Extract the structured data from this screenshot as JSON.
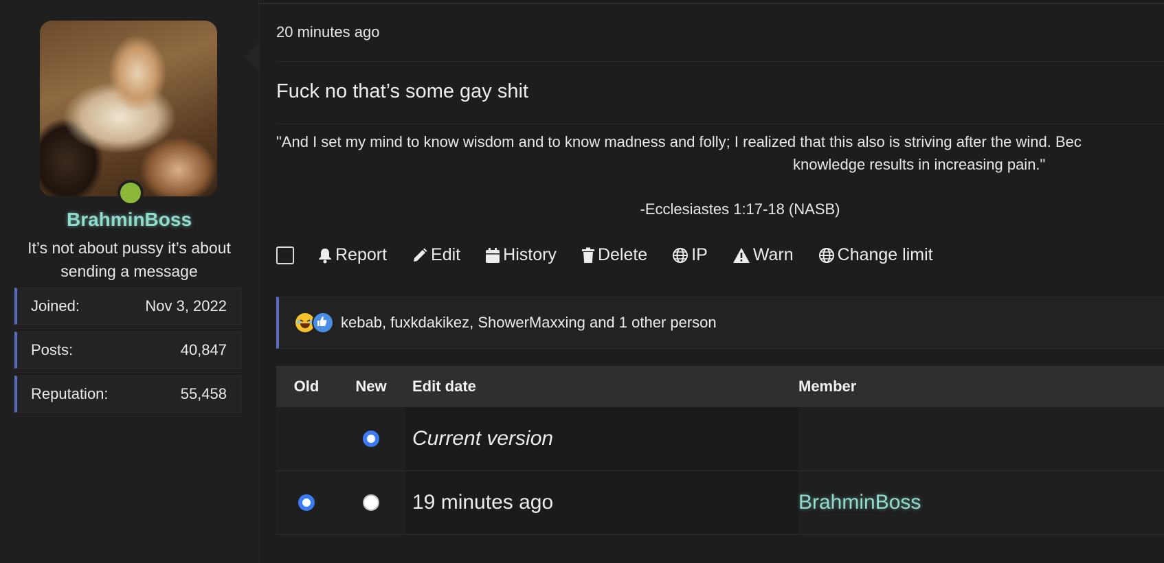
{
  "sidebar": {
    "username": "BrahminBoss",
    "user_title": "It’s not about pussy it’s about sending a message",
    "stats": [
      {
        "label": "Joined:",
        "value": "Nov 3, 2022"
      },
      {
        "label": "Posts:",
        "value": "40,847"
      },
      {
        "label": "Reputation:",
        "value": "55,458"
      }
    ],
    "online_color": "#8cb83a"
  },
  "post": {
    "date": "20 minutes ago",
    "body": "Fuck no that’s some gay shit",
    "signature": {
      "line1": "\"And I set my mind to know wisdom and to know madness and folly; I realized that this also is striving after the wind. Bec",
      "line2": "knowledge results in increasing pain.\"",
      "reference": "-Ecclesiastes 1:17-18 (NASB)"
    }
  },
  "actions": {
    "report": "Report",
    "edit": "Edit",
    "history": "History",
    "delete": "Delete",
    "ip": "IP",
    "warn": "Warn",
    "change_limit": "Change limit"
  },
  "reactions": {
    "icons": [
      "laughing-emoji",
      "like-emoji"
    ],
    "text": "kebab, fuxkdakikez, ShowerMaxxing and 1 other person"
  },
  "history_table": {
    "headers": {
      "old": "Old",
      "new": "New",
      "edit_date": "Edit date",
      "member": "Member"
    },
    "rows": [
      {
        "edit_date": "Current version",
        "member": "",
        "old_selected": false,
        "new_selected": true,
        "has_old": false
      },
      {
        "edit_date": "19 minutes ago",
        "member": "BrahminBoss",
        "old_selected": true,
        "new_selected": false,
        "has_old": true
      }
    ]
  },
  "colors": {
    "accent": "#5b6bc0",
    "username": "#8fdccf",
    "radio": "#3a7bf3"
  }
}
